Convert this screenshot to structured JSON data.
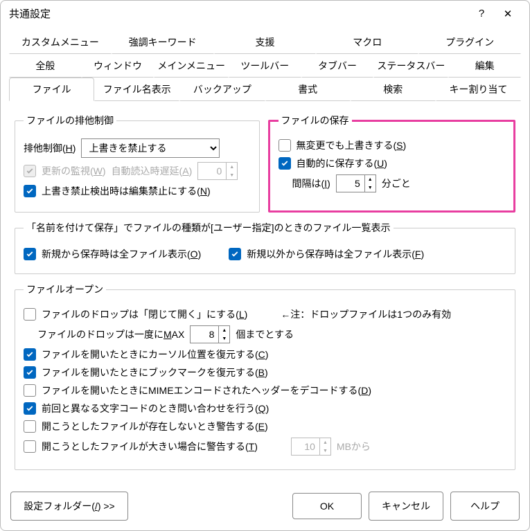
{
  "title": "共通設定",
  "helpGlyph": "?",
  "closeGlyph": "✕",
  "tabs": {
    "row1": [
      "カスタムメニュー",
      "強調キーワード",
      "支援",
      "マクロ",
      "プラグイン"
    ],
    "row2": [
      "全般",
      "ウィンドウ",
      "メインメニュー",
      "ツールバー",
      "タブバー",
      "ステータスバー",
      "編集"
    ],
    "row3": [
      "ファイル",
      "ファイル名表示",
      "バックアップ",
      "書式",
      "検索",
      "キー割り当て"
    ]
  },
  "exclusive": {
    "legend": "ファイルの排他制御",
    "modeLabelPre": "排他制御(",
    "modeHotkey": "H",
    "modeLabelPost": ")",
    "modeValue": "上書きを禁止する",
    "watchPre": "更新の監視(",
    "watchHotkey": "W",
    "watchPost": ")",
    "delayPre": "自動読込時遅延(",
    "delayHotkey": "A",
    "delayPost": ")",
    "delayValue": "0",
    "lockOnProtectPre": "上書き禁止検出時は編集禁止にする(",
    "lockOnProtectHotkey": "N",
    "lockOnProtectPost": ")"
  },
  "save": {
    "legend": "ファイルの保存",
    "overwriteUnchangedPre": "無変更でも上書きする(",
    "overwriteUnchangedHotkey": "S",
    "overwriteUnchangedPost": ")",
    "autoPre": "自動的に保存する(",
    "autoHotkey": "U",
    "autoPost": ")",
    "intervalPre": "間隔は(",
    "intervalHotkey": "I",
    "intervalPost": ")",
    "intervalValue": "5",
    "intervalSuffix": "分ごと"
  },
  "saveAs": {
    "legend": "「名前を付けて保存」でファイルの種類が[ユーザー指定]のときのファイル一覧表示",
    "newAllPre": "新規から保存時は全ファイル表示(",
    "newAllHotkey": "O",
    "newAllPost": ")",
    "nonNewAllPre": "新規以外から保存時は全ファイル表示(",
    "nonNewAllHotkey": "F",
    "nonNewAllPost": ")"
  },
  "open": {
    "legend": "ファイルオープン",
    "dropClosePre": "ファイルのドロップは「閉じて開く」にする(",
    "dropCloseHotkey": "L",
    "dropClosePost": ")",
    "dropNote": "←注：ドロップファイルは1つのみ有効",
    "dropMaxPre": "ファイルのドロップは一度に",
    "dropMaxHotkey": "M",
    "dropMaxMid": "AX",
    "dropMaxValue": "8",
    "dropMaxSuffix": "個までとする",
    "restoreCursorPre": "ファイルを開いたときにカーソル位置を復元する(",
    "restoreCursorHotkey": "C",
    "restoreCursorPost": ")",
    "restoreBookmarkPre": "ファイルを開いたときにブックマークを復元する(",
    "restoreBookmarkHotkey": "B",
    "restoreBookmarkPost": ")",
    "mimeDecodePre": "ファイルを開いたときにMIMEエンコードされたヘッダーをデコードする(",
    "mimeDecodeHotkey": "D",
    "mimeDecodePost": ")",
    "askEncodingPre": "前回と異なる文字コードのとき問い合わせを行う(",
    "askEncodingHotkey": "Q",
    "askEncodingPost": ")",
    "warnMissingPre": "開こうとしたファイルが存在しないとき警告する(",
    "warnMissingHotkey": "E",
    "warnMissingPost": ")",
    "warnBigPre": "開こうとしたファイルが大きい場合に警告する(",
    "warnBigHotkey": "T",
    "warnBigPost": ")",
    "warnBigValue": "10",
    "warnBigSuffix": "MBから"
  },
  "buttons": {
    "folderPre": "設定フォルダー(",
    "folderHotkey": "/",
    "folderPost": ") >>",
    "ok": "OK",
    "cancel": "キャンセル",
    "help": "ヘルプ"
  }
}
